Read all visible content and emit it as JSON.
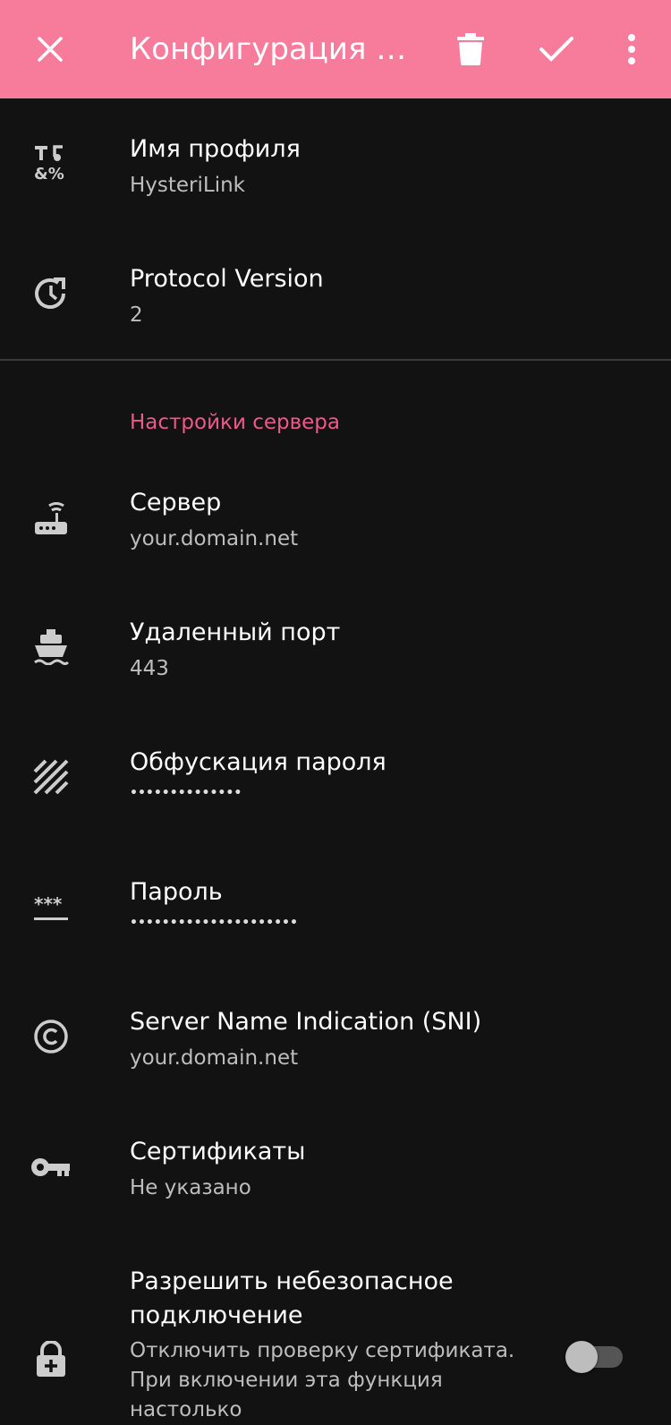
{
  "appbar": {
    "title": "Конфигурация пр...",
    "background": "#f77c9b"
  },
  "profile": {
    "name_label": "Имя профиля",
    "name_value": "HysteriLink",
    "protocol_label": "Protocol Version",
    "protocol_value": "2"
  },
  "server_section": {
    "header": "Настройки сервера",
    "items": [
      {
        "label": "Сервер",
        "value": "your.domain.net",
        "icon": "router-icon"
      },
      {
        "label": "Удаленный порт",
        "value": "443",
        "icon": "ship-icon"
      },
      {
        "label": "Обфускация пароля",
        "value": "••••••••••••••",
        "icon": "striped-square-icon"
      },
      {
        "label": "Пароль",
        "value": "•••••••••••••••••••••",
        "icon": "password-icon"
      },
      {
        "label": "Server Name Indication (SNI)",
        "value": "your.domain.net",
        "icon": "copyright-icon"
      },
      {
        "label": "Сертификаты",
        "value": "Не указано",
        "icon": "key-icon"
      }
    ],
    "insecure": {
      "label": "Разрешить небезопасное подключение",
      "description": "Отключить проверку сертификата. При включении эта функция настолько",
      "enabled": false,
      "icon": "lock-plus-icon"
    }
  },
  "colors": {
    "accent": "#f0578a",
    "background": "#121212",
    "secondary_text": "#bdbdbd"
  }
}
